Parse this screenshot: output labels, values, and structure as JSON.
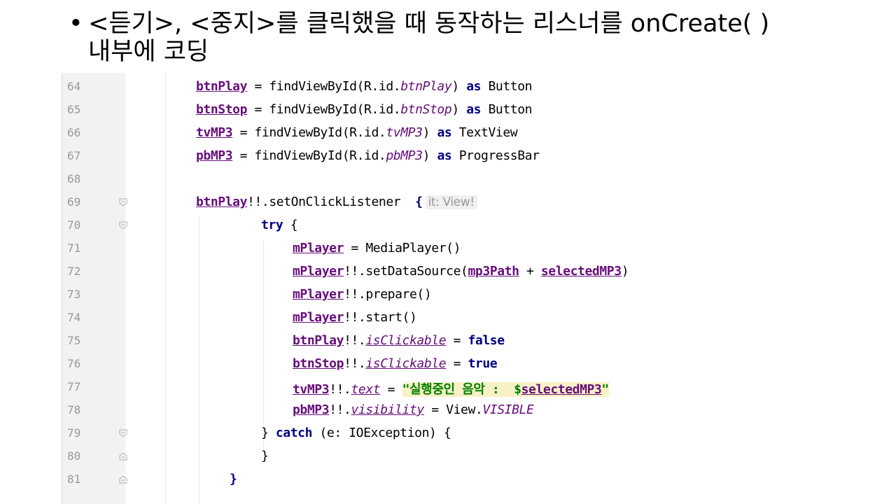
{
  "title": {
    "bullet": "•",
    "line1": "<듣기>, <중지>를 클릭했을 때 동작하는 리스너를 onCreate( )",
    "line2": "내부에 코딩"
  },
  "code": {
    "l64": {
      "num": "64",
      "a": "btnPlay",
      "b": " = findViewById(R.id.",
      "c": "btnPlay",
      "d": ") ",
      "e": "as",
      "f": " Button"
    },
    "l65": {
      "num": "65",
      "a": "btnStop",
      "b": " = findViewById(R.id.",
      "c": "btnStop",
      "d": ") ",
      "e": "as",
      "f": " Button"
    },
    "l66": {
      "num": "66",
      "a": "tvMP3",
      "b": " = findViewById(R.id.",
      "c": "tvMP3",
      "d": ") ",
      "e": "as",
      "f": " TextView"
    },
    "l67": {
      "num": "67",
      "a": "pbMP3",
      "b": " = findViewById(R.id.",
      "c": "pbMP3",
      "d": ") ",
      "e": "as",
      "f": " ProgressBar"
    },
    "l68": {
      "num": "68"
    },
    "l69": {
      "num": "69",
      "a": "btnPlay",
      "b": "!!.setOnClickListener  ",
      "c": "{",
      "hint": "it: View!"
    },
    "l70": {
      "num": "70",
      "a": "try",
      "b": " {"
    },
    "l71": {
      "num": "71",
      "a": "mPlayer",
      "b": " = MediaPlayer()"
    },
    "l72": {
      "num": "72",
      "a": "mPlayer",
      "b": "!!.setDataSource(",
      "c": "mp3Path",
      "d": " + ",
      "e": "selectedMP3",
      "f": ")"
    },
    "l73": {
      "num": "73",
      "a": "mPlayer",
      "b": "!!.prepare()"
    },
    "l74": {
      "num": "74",
      "a": "mPlayer",
      "b": "!!.start()"
    },
    "l75": {
      "num": "75",
      "a": "btnPlay",
      "b": "!!.",
      "c": "isClickable",
      "d": " = ",
      "e": "false"
    },
    "l76": {
      "num": "76",
      "a": "btnStop",
      "b": "!!.",
      "c": "isClickable",
      "d": " = ",
      "e": "true"
    },
    "l77": {
      "num": "77",
      "a": "tvMP3",
      "b": "!!.",
      "c": "text",
      "d": " = ",
      "e": "\"실행중인 음악 :  $",
      "f": "selectedMP3",
      "g": "\""
    },
    "l78": {
      "num": "78",
      "a": "pbMP3",
      "b": "!!.",
      "c": "visibility",
      "d": " = View.",
      "e": "VISIBLE"
    },
    "l79": {
      "num": "79",
      "a": "} ",
      "b": "catch",
      "c": " (e: IOException) {"
    },
    "l80": {
      "num": "80",
      "a": "}"
    },
    "l81": {
      "num": "81",
      "a": "}"
    }
  },
  "colors": {
    "keyword": "#000080",
    "property": "#660e7a",
    "string": "#008000",
    "gutter": "#f2f2f2"
  }
}
